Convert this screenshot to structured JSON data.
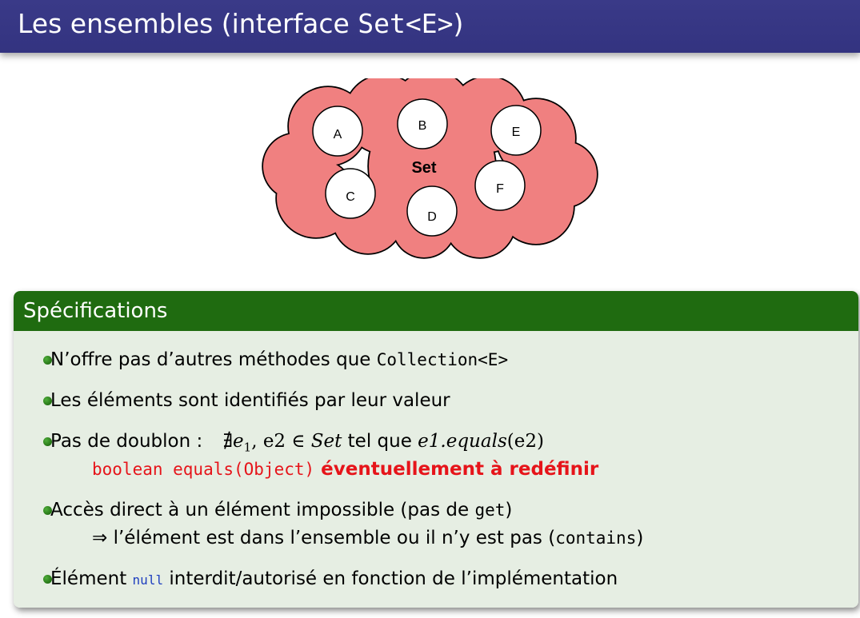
{
  "slide": {
    "title_text": "Les ensembles (interface ",
    "title_code": "Set<E>",
    "title_close": ")"
  },
  "diagram": {
    "cloud_label": "Set",
    "cloud_color": "#f08080",
    "elements": [
      "A",
      "B",
      "C",
      "D",
      "E",
      "F"
    ]
  },
  "block": {
    "title": "Spécifications",
    "header_color": "#1f6b10",
    "body_color": "#e6eee3",
    "items": [
      {
        "text": "N’offre pas d’autres méthodes que ",
        "code": "Collection<E>"
      },
      {
        "text": "Les éléments sont identifiés par leur valeur"
      },
      {
        "text": "Pas de doublon : ",
        "math": {
          "a": "∄",
          "e": "e",
          "sub": "1",
          "b": ", e2 ∈ ",
          "set": "Set",
          "c": " tel que ",
          "d": "e1.equals",
          "e2": "(e2)"
        },
        "sub_code": "boolean equals(Object)",
        "sub_emph": " éventuellement à redéfinir"
      },
      {
        "text": "Accès direct à un élément impossible (pas de ",
        "code": "get",
        "close": ")",
        "sub_arrow": "⇒",
        "sub_text": " l’élément est dans l’ensemble ou il n’y est pas (",
        "sub_code": "contains",
        "sub_close": ")"
      },
      {
        "text_a": "Élément ",
        "code": "null",
        "text_b": " interdit/autorisé en fonction de l’implémentation"
      }
    ]
  }
}
